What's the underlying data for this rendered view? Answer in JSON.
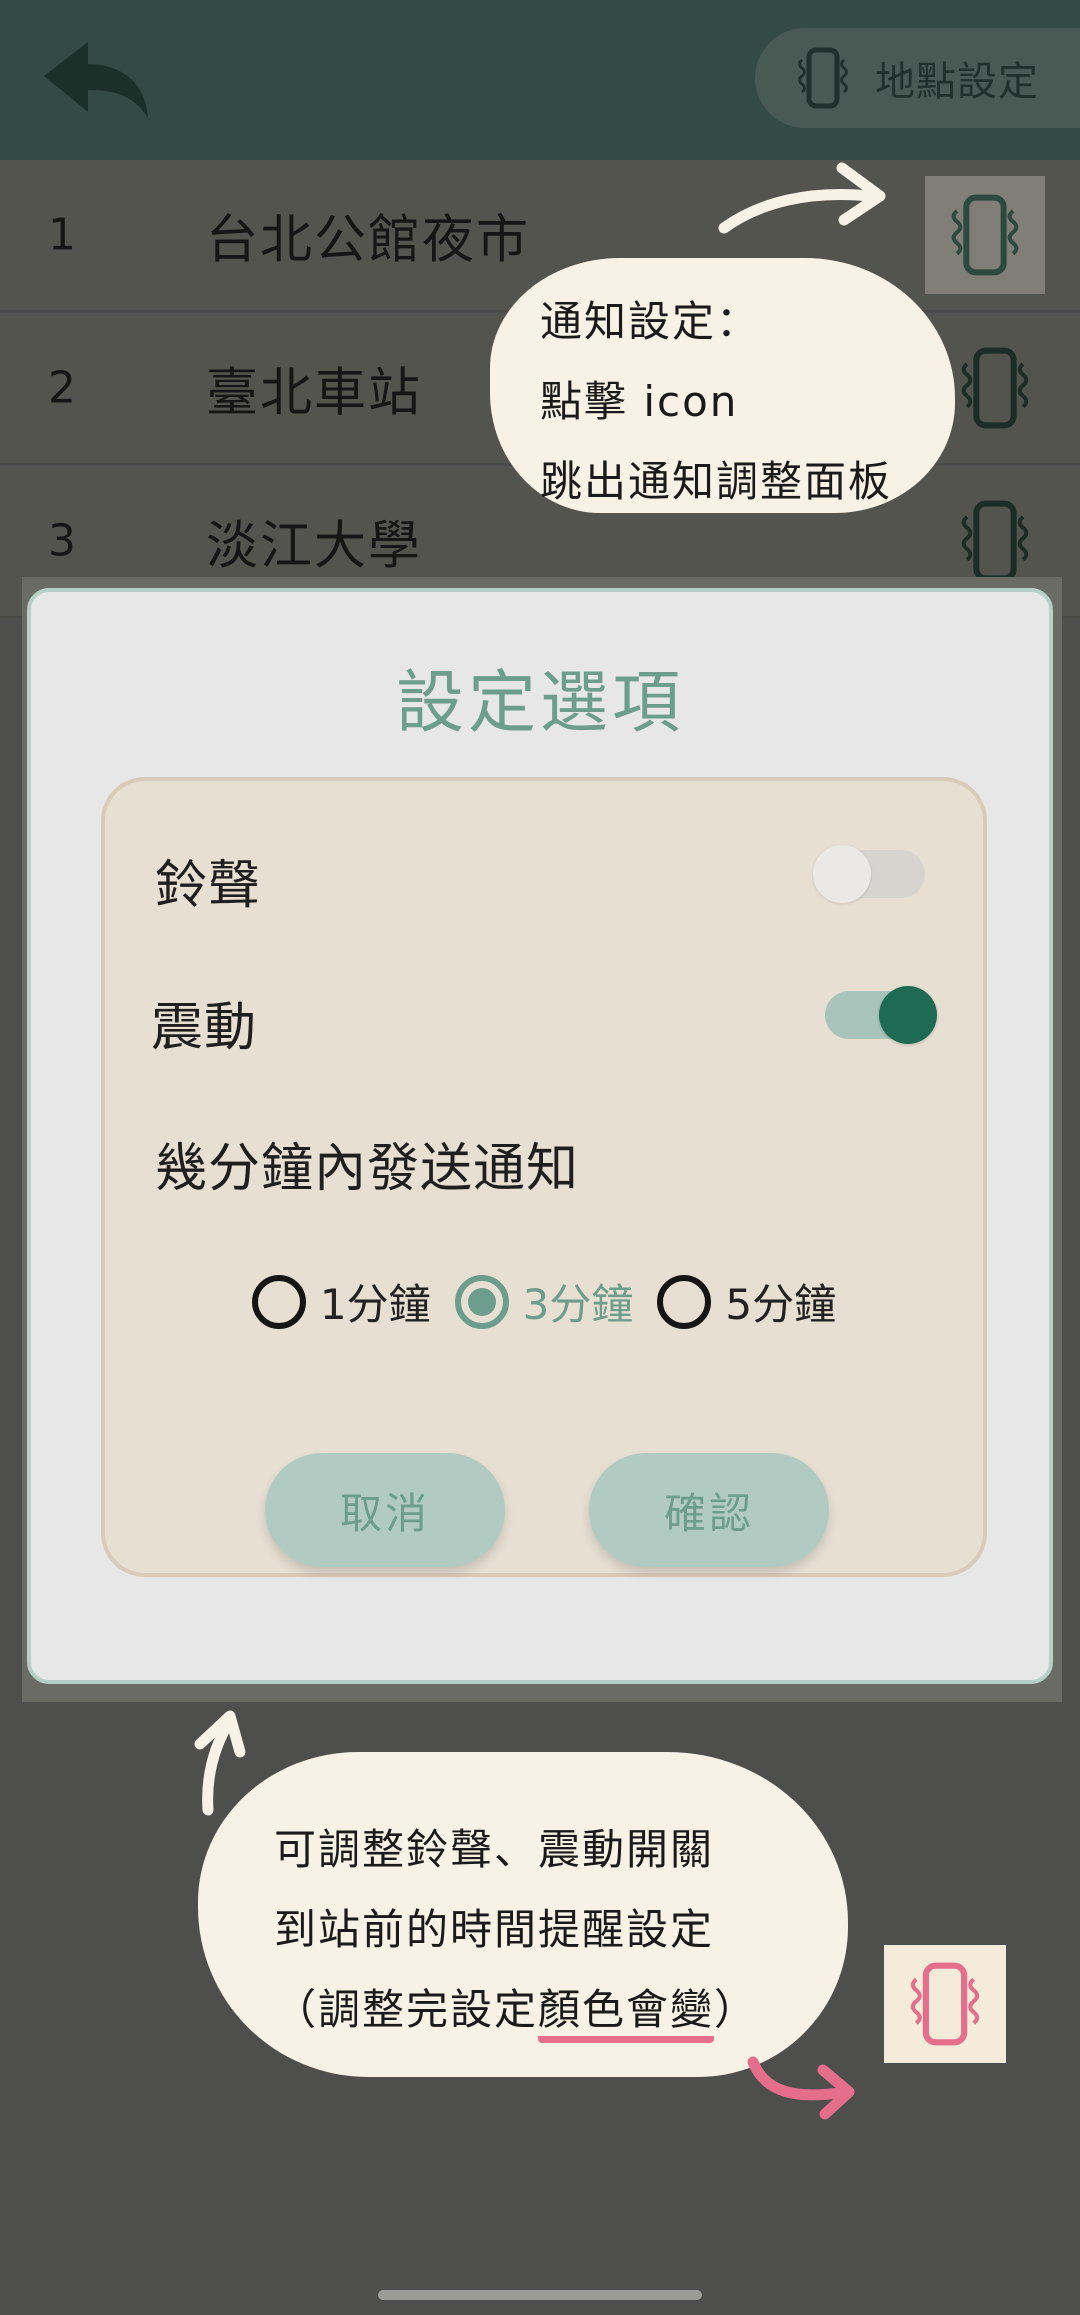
{
  "header": {
    "back_icon": "back-arrow-icon",
    "location_settings_label": "地點設定",
    "location_settings_icon": "phone-vibrate-icon"
  },
  "locations": [
    {
      "number": "1",
      "name": "台北公館夜市",
      "icon": "phone-vibrate-icon"
    },
    {
      "number": "2",
      "name": "臺北車站",
      "icon": "phone-vibrate-icon"
    },
    {
      "number": "3",
      "name": "淡江大學",
      "icon": "phone-vibrate-icon"
    }
  ],
  "dialog": {
    "title": "設定選項",
    "ringtone_label": "鈴聲",
    "ringtone_on": false,
    "vibration_label": "震動",
    "vibration_on": true,
    "notify_within_label": "幾分鐘內發送通知",
    "options": [
      {
        "label": "1分鐘",
        "checked": false
      },
      {
        "label": "3分鐘",
        "checked": true
      },
      {
        "label": "5分鐘",
        "checked": false
      }
    ],
    "cancel_label": "取消",
    "confirm_label": "確認"
  },
  "annotations": {
    "top_bubble": {
      "line1": "通知設定：",
      "line2": "點擊 icon",
      "line3": "跳出通知調整面板"
    },
    "bottom_bubble": {
      "line1": "可調整鈴聲、震動開關",
      "line2": "到站前的時間提醒設定",
      "line3_open": "（調整完設定",
      "line3_highlight": "顏色會變",
      "line3_close": "）"
    }
  },
  "colors": {
    "header_bg": "#344a45",
    "accent_green": "#6d9d8c",
    "toggle_on": "#1f6a52",
    "button_bg": "#b2cbc2",
    "panel_bg": "#e7dfd2",
    "annotation_pink": "#e46e8c",
    "bubble_bg": "#f8f1e6"
  }
}
